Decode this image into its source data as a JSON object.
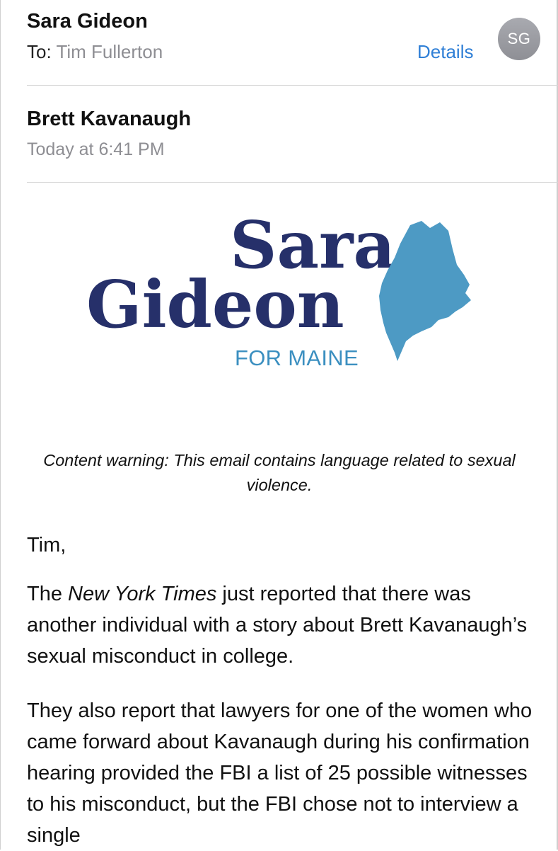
{
  "header": {
    "sender": "Sara Gideon",
    "to_label": "To:",
    "to_name": "Tim Fullerton",
    "details_label": "Details",
    "avatar_initials": "SG"
  },
  "message": {
    "subject": "Brett Kavanaugh",
    "date": "Today at 6:41 PM"
  },
  "logo": {
    "line1": "Sara",
    "line2": "Gideon",
    "tagline": "FOR MAINE",
    "colors": {
      "wordmark": "#26306a",
      "state": "#4d9ac4"
    }
  },
  "content": {
    "warning": "Content warning: This email contains language related to sexual violence.",
    "greeting": "Tim,",
    "p1_prefix": "The ",
    "p1_italic": "New York Times",
    "p1_rest": " just reported that there was another individual with a story about Brett Kavanaugh’s sexual misconduct in college.",
    "p2": "They also report that lawyers for one of the women who came forward about Kavanaugh during his confirmation hearing provided the FBI a list of 25 possible witnesses to his misconduct, but the FBI chose not to interview a single"
  },
  "colors": {
    "link": "#2f7fd6",
    "secondary_text": "#8e8e93"
  }
}
